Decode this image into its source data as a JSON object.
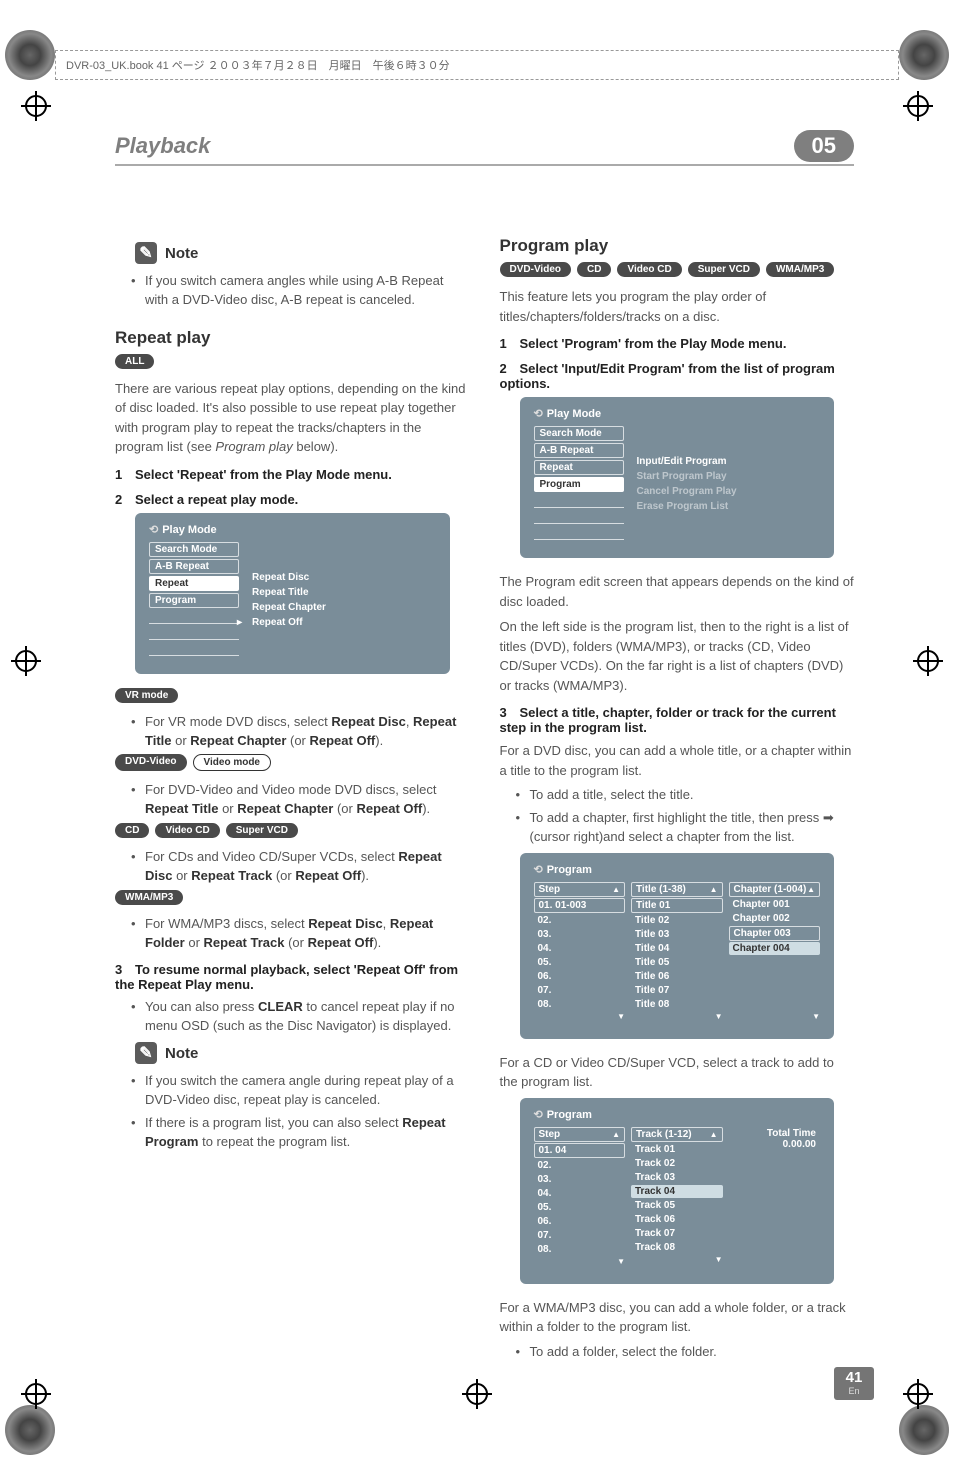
{
  "meta": {
    "dash_text": "DVR-03_UK.book 41 ページ ２００３年７月２８日　月曜日　午後６時３０分"
  },
  "header": {
    "title": "Playback",
    "chapter": "05"
  },
  "left": {
    "note1_label": "Note",
    "note1_bul1": "If you switch camera angles while using A-B Repeat with a DVD-Video disc, A-B repeat is canceled.",
    "repeat_heading": "Repeat play",
    "badge_all": "ALL",
    "repeat_p1": "There are various repeat play options, depending on the kind of disc loaded. It's also possible to use repeat play together with program play to repeat the tracks/chapters in the program list (see ",
    "repeat_p1_em": "Program play",
    "repeat_p1_tail": " below).",
    "step1": "Select 'Repeat' from the Play Mode menu.",
    "step2": "Select a repeat play mode.",
    "osd1": {
      "title": "Play Mode",
      "left": [
        "Search Mode",
        "A-B Repeat",
        "Repeat",
        "Program"
      ],
      "right": [
        "Repeat Disc",
        "Repeat Title",
        "Repeat Chapter",
        "Repeat Off"
      ]
    },
    "badge_vr": "VR mode",
    "vr_text_a": "For VR mode DVD discs, select ",
    "vr_strong1": "Repeat Disc",
    "vr_sep": ", ",
    "vr_strong2": "Repeat Title",
    "vr_or": " or ",
    "vr_strong3": "Repeat Chapter",
    "vr_paren_a": " (or ",
    "vr_strong4": "Repeat Off",
    "vr_paren_b": ").",
    "badge_dvdvideo": "DVD-Video",
    "badge_videomode": "Video mode",
    "dvdv_text_a": "For DVD-Video and Video mode DVD discs, select ",
    "dvdv_strong1": "Repeat Title",
    "dvdv_or": " or ",
    "dvdv_strong2": "Repeat Chapter",
    "dvdv_paren_a": " (or ",
    "dvdv_strong3": "Repeat Off",
    "dvdv_paren_b": ").",
    "badge_cd": "CD",
    "badge_videocd": "Video CD",
    "badge_svcd": "Super VCD",
    "cd_text_a": "For CDs and Video CD/Super VCDs, select ",
    "cd_strong1": "Repeat Disc",
    "cd_or": " or ",
    "cd_strong2": "Repeat Track",
    "cd_paren_a": " (or ",
    "cd_strong3": "Repeat Off",
    "cd_paren_b": ").",
    "badge_wma": "WMA/MP3",
    "wma_text_a": "For WMA/MP3 discs, select ",
    "wma_strong1": "Repeat Disc",
    "wma_sep": ", ",
    "wma_strong2": "Repeat Folder",
    "wma_or": " or ",
    "wma_strong3": "Repeat Track",
    "wma_paren_a": " (or ",
    "wma_strong4": "Repeat Off",
    "wma_paren_b": ").",
    "step3": "To resume normal playback, select 'Repeat Off' from the Repeat Play menu.",
    "resume_bul_a": "You can also press ",
    "resume_strong": "CLEAR",
    "resume_bul_b": " to cancel repeat play if no menu OSD (such as the Disc Navigator) is displayed.",
    "note2_label": "Note",
    "note2_bul1": "If you switch the camera angle during repeat play of a DVD-Video disc, repeat play is canceled.",
    "note2_bul2a": "If there is a program list, you can also select ",
    "note2_strong": "Repeat Program",
    "note2_bul2b": " to repeat the program list."
  },
  "right": {
    "prog_heading": "Program play",
    "badges": [
      "DVD-Video",
      "CD",
      "Video CD",
      "Super VCD",
      "WMA/MP3"
    ],
    "prog_p1": "This feature lets you program the play order of titles/chapters/folders/tracks on a disc.",
    "step1": "Select 'Program' from the Play Mode menu.",
    "step2": "Select 'Input/Edit Program' from the list of program options.",
    "osd1": {
      "title": "Play Mode",
      "left": [
        "Search Mode",
        "A-B Repeat",
        "Repeat",
        "Program"
      ],
      "right": [
        "Input/Edit Program",
        "Start Program Play",
        "Cancel Program Play",
        "Erase Program List"
      ]
    },
    "after_osd1_p1": "The Program edit screen that appears depends on the kind of disc loaded.",
    "after_osd1_p2": "On the left side is the program list, then to the right is a list of titles (DVD), folders (WMA/MP3), or tracks (CD, Video CD/Super VCDs). On the far right is a list of chapters (DVD) or tracks (WMA/MP3).",
    "step3": "Select a title, chapter, folder or track for the current step in the program list.",
    "step3_p": "For a DVD disc, you can add a whole title, or a chapter within a title to the program list.",
    "step3_bul1": "To add a title, select the title.",
    "step3_bul2": "To add a chapter, first highlight the title, then press ➡ (cursor right)and select a chapter from the list.",
    "osd2": {
      "title": "Program",
      "col1_hdr": "Step",
      "col1": [
        "01. 01-003",
        "02.",
        "03.",
        "04.",
        "05.",
        "06.",
        "07.",
        "08."
      ],
      "col2_hdr": "Title (1-38)",
      "col2": [
        "Title 01",
        "Title 02",
        "Title 03",
        "Title 04",
        "Title 05",
        "Title 06",
        "Title 07",
        "Title 08"
      ],
      "col3_hdr": "Chapter (1-004)",
      "col3": [
        "Chapter 001",
        "Chapter 002",
        "Chapter 003",
        "Chapter 004"
      ]
    },
    "after_osd2_p": "For a CD or Video CD/Super VCD, select a track to add to the program list.",
    "osd3": {
      "title": "Program",
      "col1_hdr": "Step",
      "col1": [
        "01. 04",
        "02.",
        "03.",
        "04.",
        "05.",
        "06.",
        "07.",
        "08."
      ],
      "col2_hdr": "Track (1-12)",
      "col2": [
        "Track 01",
        "Track 02",
        "Track 03",
        "Track 04",
        "Track 05",
        "Track 06",
        "Track 07",
        "Track 08"
      ],
      "totaltime": "Total Time 0.00.00"
    },
    "after_osd3_p": "For a WMA/MP3 disc, you can add a whole folder, or a track within a folder to the program list.",
    "after_osd3_bul": "To add a folder, select the folder."
  },
  "footer": {
    "page": "41",
    "lang": "En"
  }
}
